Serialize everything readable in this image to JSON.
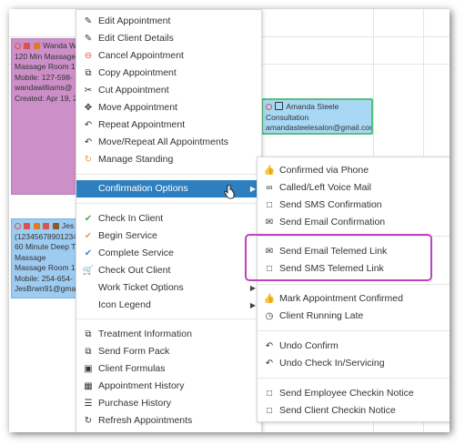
{
  "appointments": {
    "pink": {
      "lines": [
        "Wanda W",
        "120 Min Massage",
        "Massage Room 1",
        "Mobile: 127-598-",
        "wandawilliams@",
        "Created: Apr 19, 2"
      ]
    },
    "blue": {
      "lines": [
        "Jes",
        "(12345678901234",
        "60 Minute Deep T",
        "Massage",
        "Massage Room 1",
        "Mobile: 254-654-",
        "JesBrwn91@gmai"
      ]
    },
    "green": {
      "name": "Amanda Steele",
      "type": "Consultation",
      "email": "amandasteelesalon@gmail.com"
    }
  },
  "main_menu": {
    "items": [
      {
        "label": "Edit Appointment",
        "icon": "pencil-icon"
      },
      {
        "label": "Edit Client Details",
        "icon": "pencil-icon"
      },
      {
        "label": "Cancel Appointment",
        "icon": "cancel-icon"
      },
      {
        "label": "Copy Appointment",
        "icon": "copy-icon"
      },
      {
        "label": "Cut Appointment",
        "icon": "scissors-icon"
      },
      {
        "label": "Move Appointment",
        "icon": "move-icon"
      },
      {
        "label": "Repeat Appointment",
        "icon": "repeat-icon"
      },
      {
        "label": "Move/Repeat All Appointments",
        "icon": "repeat-icon"
      },
      {
        "label": "Manage Standing",
        "icon": "standing-icon"
      },
      {
        "label": "Confirmation Options",
        "icon": ""
      },
      {
        "label": "Check In Client",
        "icon": "check-circle-icon"
      },
      {
        "label": "Begin Service",
        "icon": "check-circle-icon"
      },
      {
        "label": "Complete Service",
        "icon": "check-circle-icon"
      },
      {
        "label": "Check Out Client",
        "icon": "cart-icon"
      },
      {
        "label": "Work Ticket Options",
        "icon": ""
      },
      {
        "label": "Icon Legend",
        "icon": ""
      },
      {
        "label": "Treatment Information",
        "icon": "document-icon"
      },
      {
        "label": "Send Form Pack",
        "icon": "document-icon"
      },
      {
        "label": "Client Formulas",
        "icon": "flask-icon"
      },
      {
        "label": "Appointment History",
        "icon": "calendar-icon"
      },
      {
        "label": "Purchase History",
        "icon": "list-icon"
      },
      {
        "label": "Refresh Appointments",
        "icon": "refresh-icon"
      }
    ]
  },
  "sub_menu": {
    "items": [
      {
        "label": "Confirmed via Phone",
        "icon": "thumbs-up-icon"
      },
      {
        "label": "Called/Left Voice Mail",
        "icon": "voicemail-icon"
      },
      {
        "label": "Send SMS Confirmation",
        "icon": "sms-icon"
      },
      {
        "label": "Send Email Confirmation",
        "icon": "email-icon"
      },
      {
        "label": "Send Email Telemed Link",
        "icon": "email-icon"
      },
      {
        "label": "Send SMS Telemed Link",
        "icon": "sms-icon"
      },
      {
        "label": "Mark Appointment Confirmed",
        "icon": "thumbs-up-icon"
      },
      {
        "label": "Client Running Late",
        "icon": "clock-icon"
      },
      {
        "label": "Undo Confirm",
        "icon": "undo-icon"
      },
      {
        "label": "Undo Check In/Servicing",
        "icon": "undo-icon"
      },
      {
        "label": "Send Employee Checkin Notice",
        "icon": "sms-icon"
      },
      {
        "label": "Send Client Checkin Notice",
        "icon": "sms-icon"
      }
    ]
  },
  "colors": {
    "active_item": "#2e7fbf",
    "highlight": "#c23fc4"
  }
}
